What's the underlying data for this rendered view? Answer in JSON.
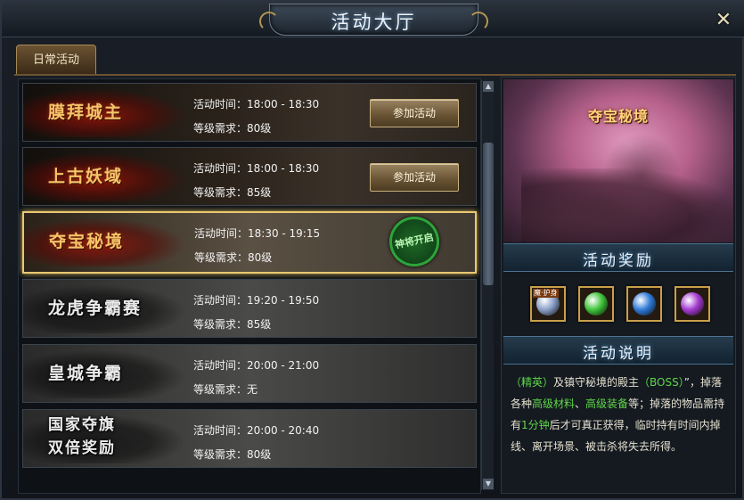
{
  "window": {
    "title": "活动大厅",
    "close_label": "✕"
  },
  "tabs": [
    {
      "label": "日常活动",
      "active": true
    }
  ],
  "activities": [
    {
      "name": "膜拜城主",
      "time": "活动时间：18:00 - 18:30",
      "level": "等级需求：80级",
      "action": "参加活动",
      "style": "dark"
    },
    {
      "name": "上古妖域",
      "time": "活动时间：18:00 - 18:30",
      "level": "等级需求：85级",
      "action": "参加活动",
      "style": "dark"
    },
    {
      "name": "夺宝秘境",
      "time": "活动时间：18:30 - 19:15",
      "level": "等级需求：80级",
      "badge": "神将开启",
      "style": "selected"
    },
    {
      "name": "龙虎争霸赛",
      "time": "活动时间：19:20 - 19:50",
      "level": "等级需求：85级",
      "style": "grey"
    },
    {
      "name": "皇城争霸",
      "time": "活动时间：20:00 - 21:00",
      "level": "等级需求：无",
      "style": "grey"
    },
    {
      "name_line1": "国家夺旗",
      "name_line2": "双倍奖励",
      "time": "活动时间：20:00 - 20:40",
      "level": "等级需求：80级",
      "style": "grey"
    }
  ],
  "scrollbar": {
    "up_icon": "▲",
    "down_icon": "▼"
  },
  "detail": {
    "preview_title": "夺宝秘境",
    "rewards_header": "活动奖励",
    "rewards": [
      {
        "icon": "sword-armor-icon",
        "tag": "魔·护身",
        "color": "#8aa0c8"
      },
      {
        "icon": "green-dragon-icon",
        "color": "#3fc43a"
      },
      {
        "icon": "blue-dragon-icon",
        "color": "#2f7ad8"
      },
      {
        "icon": "purple-dragon-icon",
        "color": "#a43ad0"
      }
    ],
    "description_header": "活动说明",
    "description": {
      "p1_g1": "（精英）",
      "p1_t1": "及镇守秘境的殿主",
      "p1_g2": "（BOSS）",
      "p1_t2": "”，掉落各种",
      "p1_g3": "高级材料",
      "p1_t3": "、",
      "p1_g4": "高级装备",
      "p1_t4": "等；掉落的物品需持有",
      "p1_g5": "1分钟",
      "p1_t5": "后才可真正获得，临时持有时间内掉线、离开场景、被击杀将失去所得。"
    }
  },
  "colors": {
    "gold_border": "#e8c872",
    "accent_green": "#5fd64a",
    "title_glow": "#7fb0e0"
  }
}
